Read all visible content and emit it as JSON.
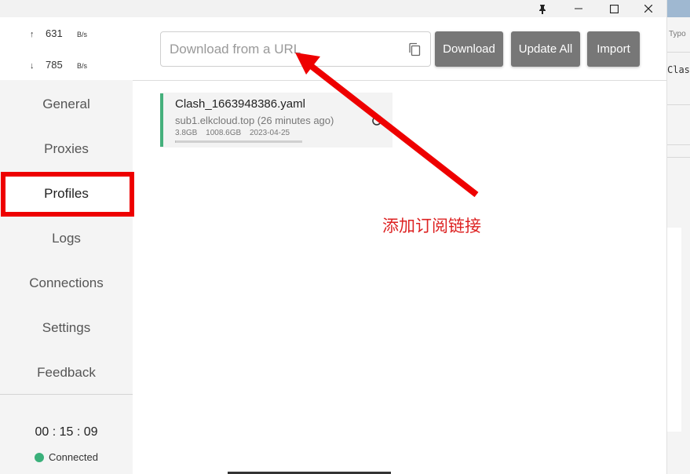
{
  "titlebar": {
    "pin_icon": "pin-icon",
    "minimize_icon": "minimize-icon",
    "maximize_icon": "maximize-icon",
    "close_icon": "close-icon"
  },
  "traffic": {
    "up_arrow": "↑",
    "up_value": "631",
    "up_unit": "B/s",
    "down_arrow": "↓",
    "down_value": "785",
    "down_unit": "B/s"
  },
  "sidebar": {
    "items": [
      {
        "label": "General"
      },
      {
        "label": "Proxies"
      },
      {
        "label": "Profiles"
      },
      {
        "label": "Logs"
      },
      {
        "label": "Connections"
      },
      {
        "label": "Settings"
      },
      {
        "label": "Feedback"
      }
    ],
    "active_item": "Profiles",
    "timer": "00 : 15 : 09",
    "status": "Connected",
    "status_color": "#3ab07a",
    "highlight_color": "#ee0000"
  },
  "header": {
    "url_placeholder": "Download from a URL",
    "download_label": "Download",
    "update_all_label": "Update All",
    "import_label": "Import"
  },
  "profile": {
    "name": "Clash_1663948386.yaml",
    "source": "sub1.elkcloud.top (26 minutes ago)",
    "used": "3.8GB",
    "total": "1008.6GB",
    "expires": "2023-04-25",
    "usage_fraction": 0.004,
    "accent_color": "#45b07c"
  },
  "annotation": {
    "label": "添加订阅链接",
    "color": "#dd2222"
  },
  "background_window": {
    "typo_text": "Typo",
    "clash_text": "Clasl"
  }
}
